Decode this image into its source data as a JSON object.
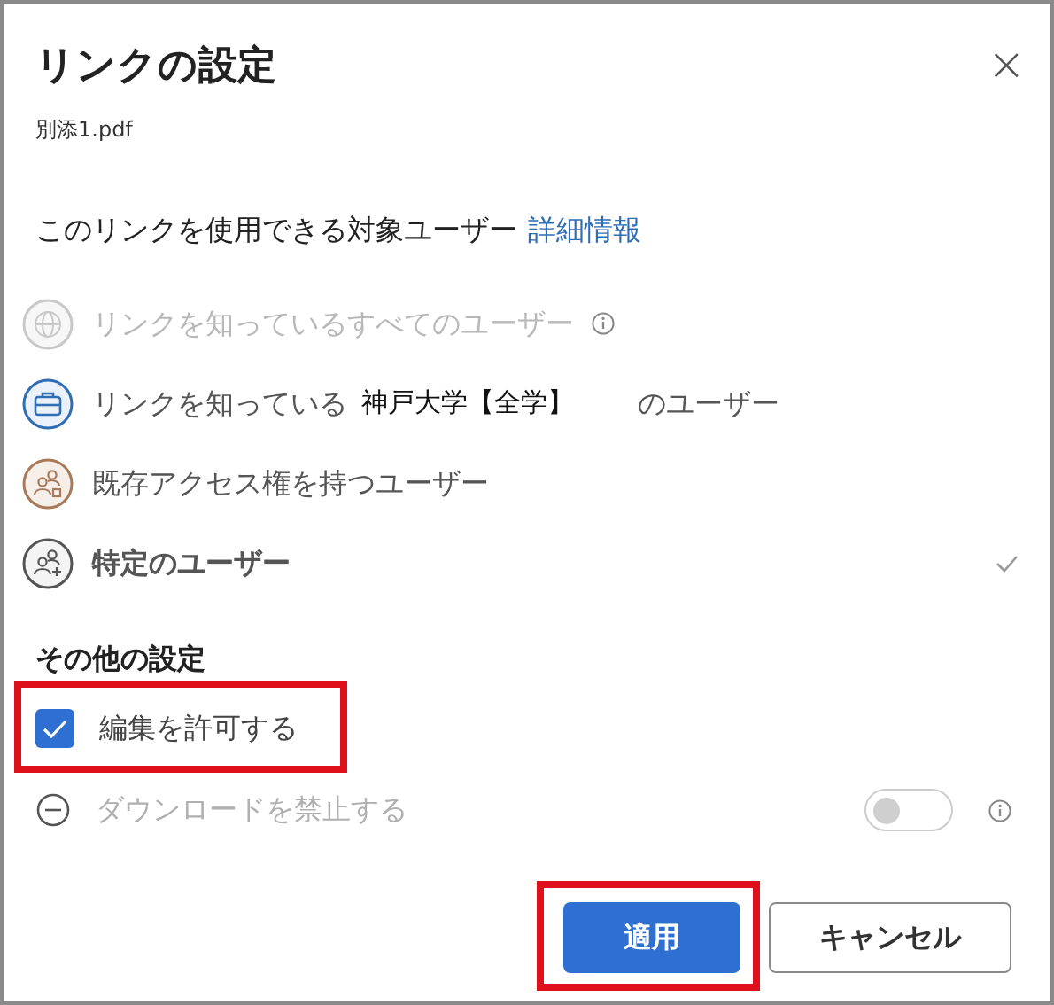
{
  "dialog": {
    "title": "リンクの設定",
    "close": "×",
    "file_name": "別添1.pdf"
  },
  "audience": {
    "heading": "このリンクを使用できる対象ユーザー",
    "link": "詳細情報",
    "options": [
      {
        "kind": "globe",
        "text": "リンクを知っているすべてのユーザー",
        "disabled": true,
        "selected": false,
        "info": true
      },
      {
        "kind": "org",
        "text": "リンクを知っている",
        "org": "神戸大学【全学】",
        "suffix": "のユーザー",
        "disabled": false,
        "selected": false,
        "info": false
      },
      {
        "kind": "existing",
        "text": "既存アクセス権を持つユーザー",
        "disabled": false,
        "selected": false,
        "info": false
      },
      {
        "kind": "specific",
        "text": "特定のユーザー",
        "disabled": false,
        "selected": true,
        "info": false
      }
    ]
  },
  "other": {
    "heading": "その他の設定",
    "settings": [
      {
        "kind": "checkbox",
        "label": "編集を許可する",
        "checked": true,
        "disabled": false,
        "highlighted": true
      },
      {
        "kind": "toggle",
        "label": "ダウンロードを禁止する",
        "on": false,
        "disabled": true,
        "highlighted": false
      }
    ]
  },
  "buttons": [
    {
      "label": "適用",
      "primary": true,
      "highlighted": true
    },
    {
      "label": "キャンセル",
      "primary": false,
      "highlighted": false
    }
  ]
}
